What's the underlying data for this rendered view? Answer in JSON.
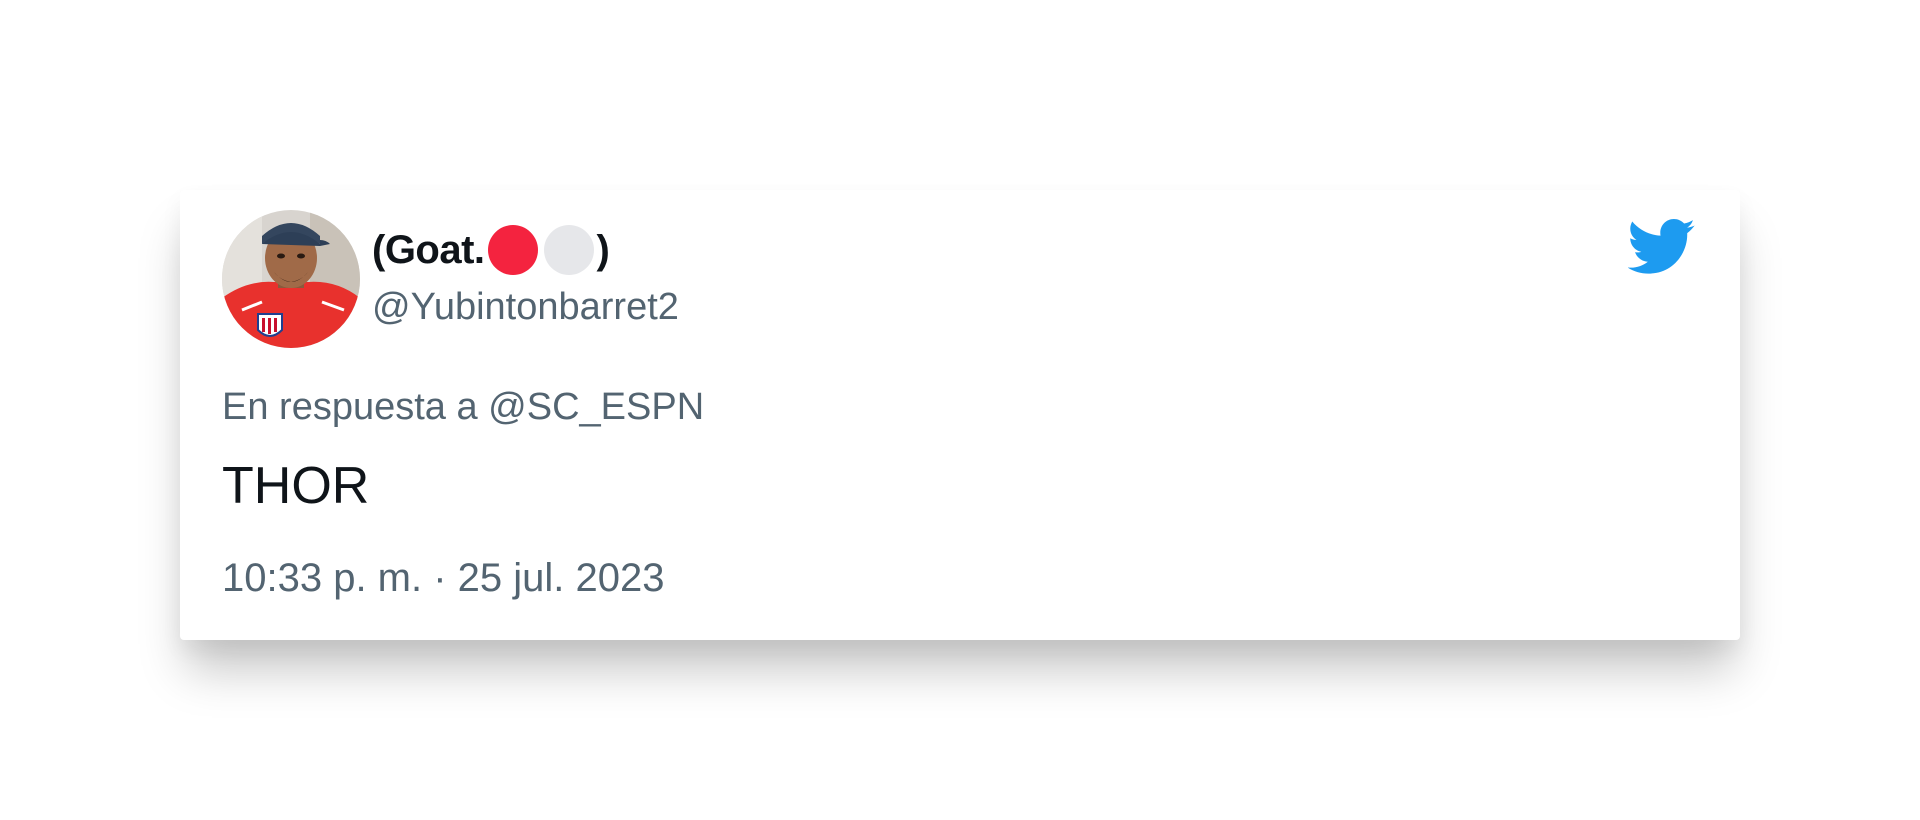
{
  "tweet": {
    "display_name_prefix": "(Goat.",
    "display_name_emoji": [
      {
        "name": "red-circle",
        "color": "#f4233f"
      },
      {
        "name": "white-circle",
        "color": "#e6e7ea"
      }
    ],
    "display_name_suffix": ")",
    "handle": "@Yubintonbarret2",
    "reply_to": "En respuesta a @SC_ESPN",
    "text": "THOR",
    "timestamp": "10:33 p. m. · 25 jul. 2023"
  },
  "icons": {
    "brand": "twitter-bird-icon",
    "brand_color": "#1d9bf0"
  }
}
